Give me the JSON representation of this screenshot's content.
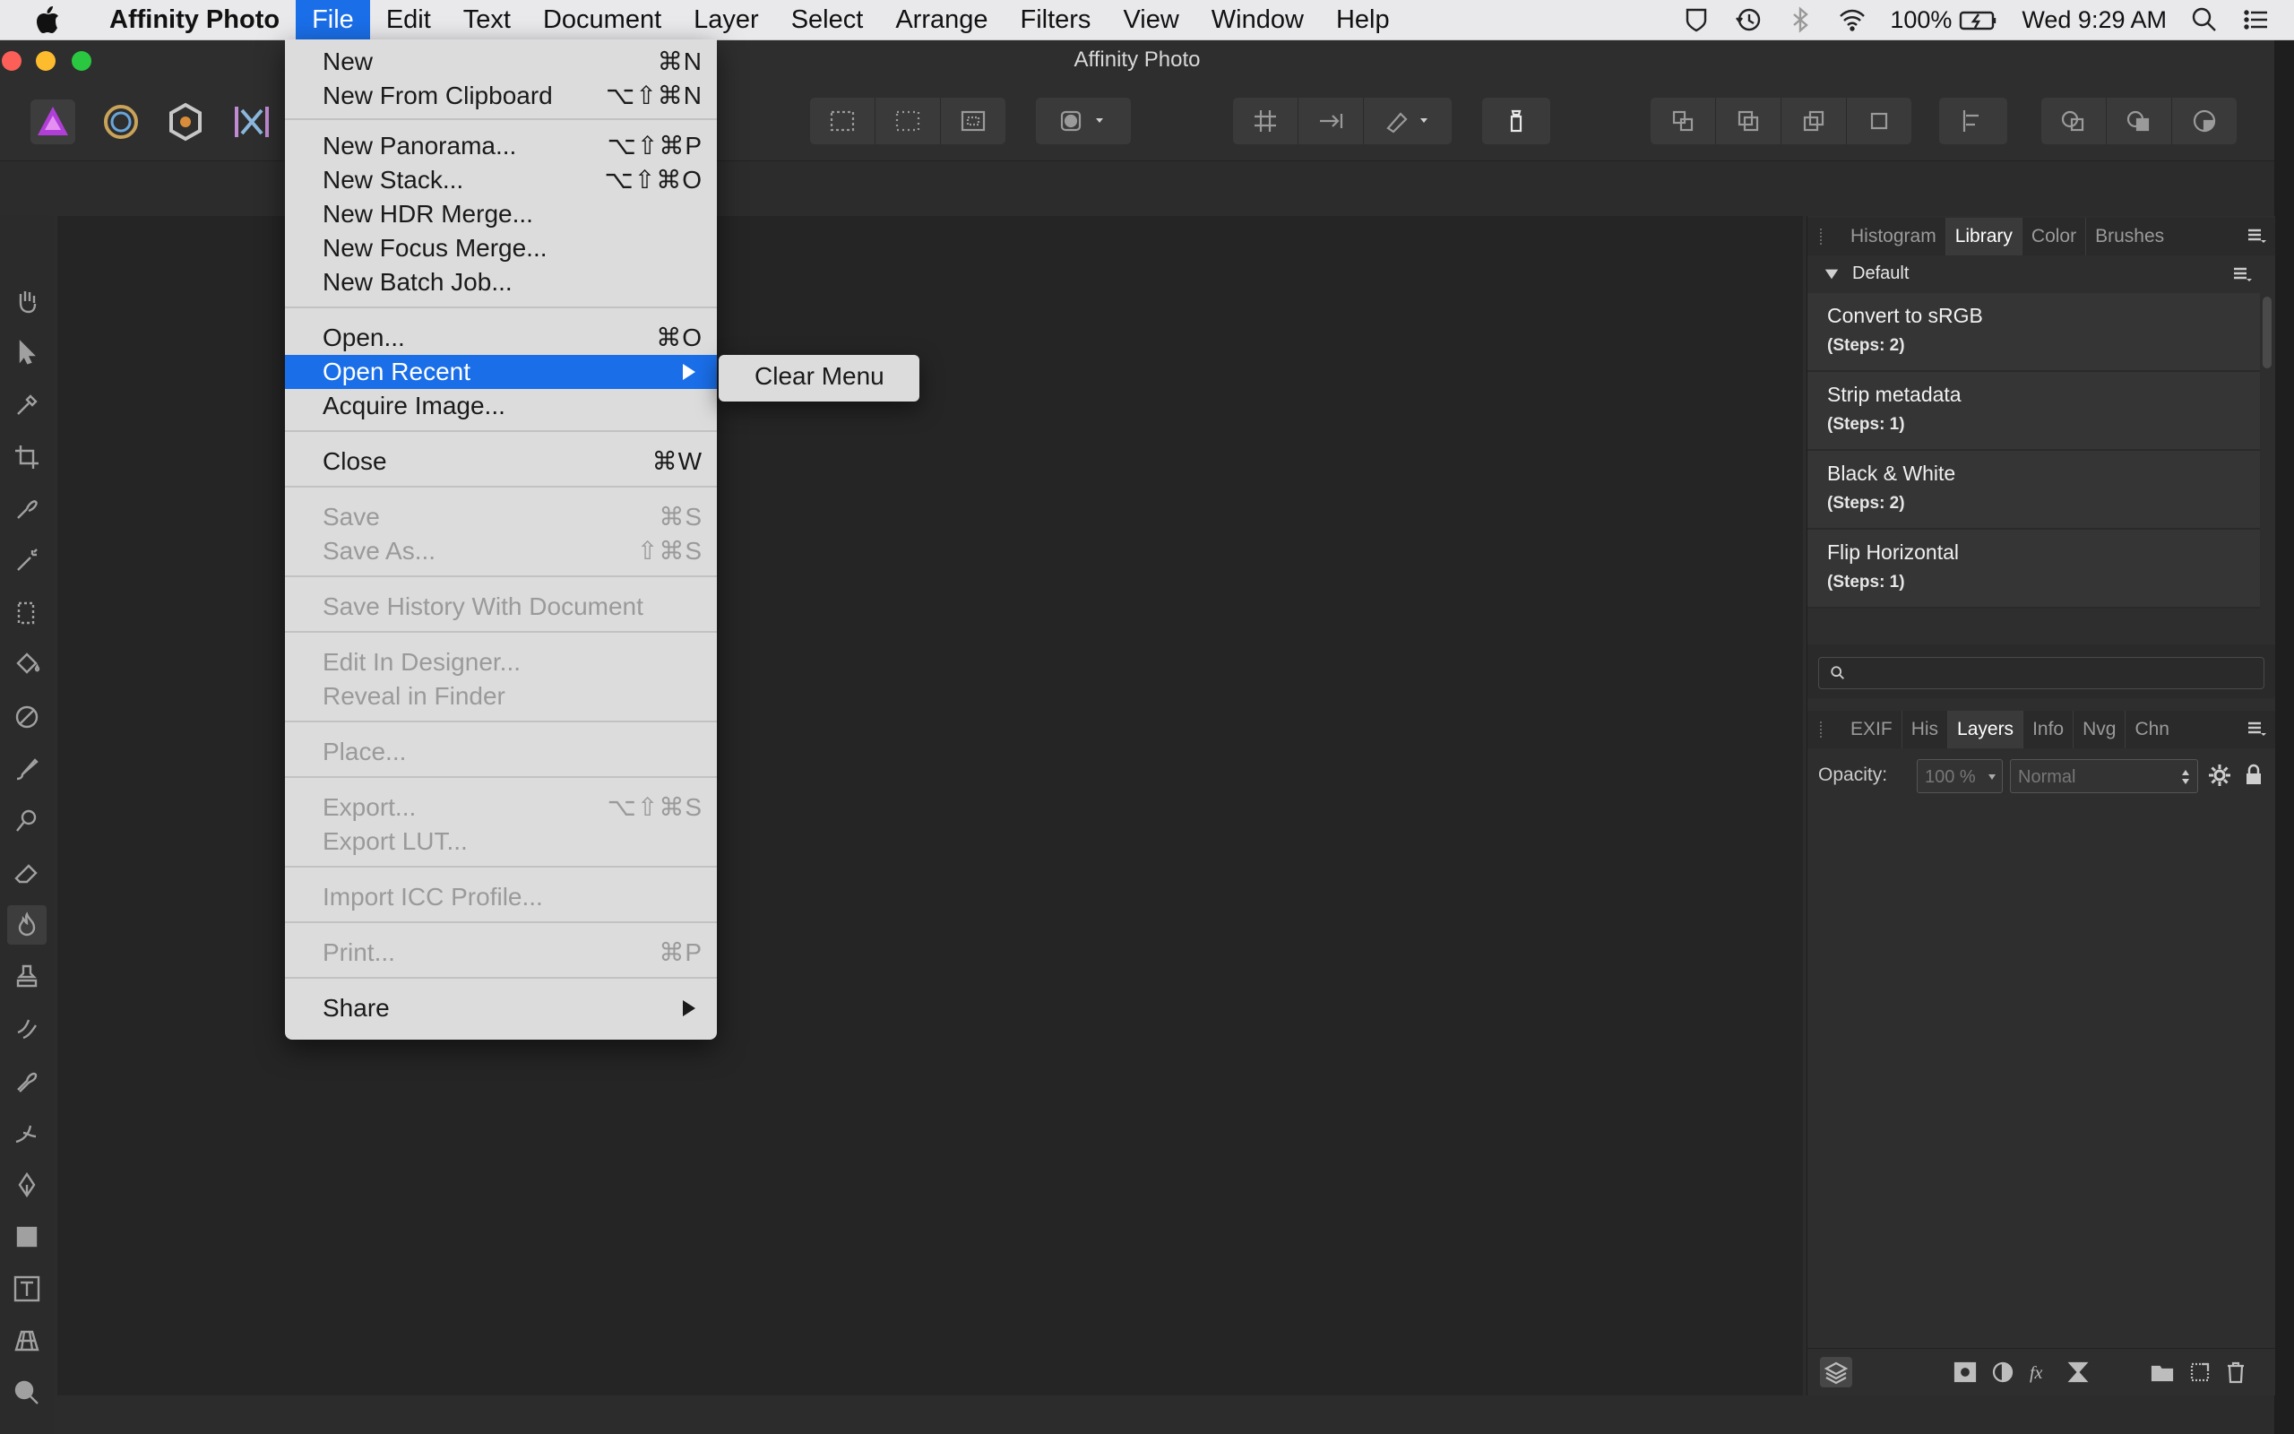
{
  "menubar": {
    "app_name": "Affinity Photo",
    "items": [
      "File",
      "Edit",
      "Text",
      "Document",
      "Layer",
      "Select",
      "Arrange",
      "Filters",
      "View",
      "Window",
      "Help"
    ],
    "battery": "100%",
    "clock": "Wed 9:29 AM"
  },
  "window": {
    "title": "Affinity Photo"
  },
  "file_menu": {
    "items": [
      {
        "label": "New",
        "shortcut": "⌘N"
      },
      {
        "label": "New From Clipboard",
        "shortcut": "⌥⇧⌘N"
      },
      {
        "label": "New Panorama...",
        "shortcut": "⌥⇧⌘P"
      },
      {
        "label": "New Stack...",
        "shortcut": "⌥⇧⌘O"
      },
      {
        "label": "New HDR Merge...",
        "shortcut": ""
      },
      {
        "label": "New Focus Merge...",
        "shortcut": ""
      },
      {
        "label": "New Batch Job...",
        "shortcut": ""
      },
      {
        "label": "Open...",
        "shortcut": "⌘O"
      },
      {
        "label": "Open Recent",
        "shortcut": ""
      },
      {
        "label": "Acquire Image...",
        "shortcut": ""
      },
      {
        "label": "Close",
        "shortcut": "⌘W"
      },
      {
        "label": "Save",
        "shortcut": "⌘S"
      },
      {
        "label": "Save As...",
        "shortcut": "⇧⌘S"
      },
      {
        "label": "Save History With Document",
        "shortcut": ""
      },
      {
        "label": "Edit In Designer...",
        "shortcut": ""
      },
      {
        "label": "Reveal in Finder",
        "shortcut": ""
      },
      {
        "label": "Place...",
        "shortcut": ""
      },
      {
        "label": "Export...",
        "shortcut": "⌥⇧⌘S"
      },
      {
        "label": "Export LUT...",
        "shortcut": ""
      },
      {
        "label": "Import ICC Profile...",
        "shortcut": ""
      },
      {
        "label": "Print...",
        "shortcut": "⌘P"
      },
      {
        "label": "Share",
        "shortcut": ""
      }
    ]
  },
  "open_recent_submenu": {
    "items": [
      "Clear Menu"
    ]
  },
  "library_panel": {
    "tabs": [
      "Histogram",
      "Library",
      "Color",
      "Brushes"
    ],
    "category": "Default",
    "macros": [
      {
        "name": "Convert to sRGB",
        "steps": "(Steps: 2)"
      },
      {
        "name": "Strip metadata",
        "steps": "(Steps: 1)"
      },
      {
        "name": "Black & White",
        "steps": "(Steps: 2)"
      },
      {
        "name": "Flip Horizontal",
        "steps": "(Steps: 1)"
      }
    ]
  },
  "layers_panel": {
    "tabs": [
      "EXIF",
      "His",
      "Layers",
      "Info",
      "Nvg",
      "Chn"
    ],
    "opacity_label": "Opacity:",
    "opacity_value": "100 %",
    "blend_mode": "Normal"
  }
}
